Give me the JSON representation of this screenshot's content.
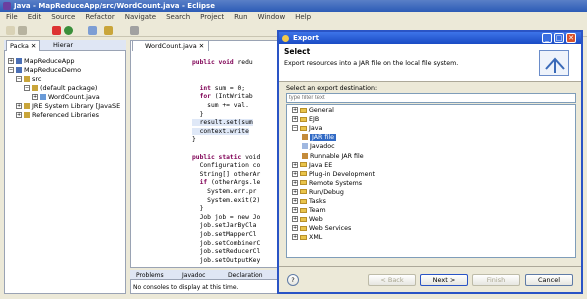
{
  "window": {
    "title": "Java - MapReduceApp/src/WordCount.java - Eclipse"
  },
  "menu": [
    "File",
    "Edit",
    "Source",
    "Refactor",
    "Navigate",
    "Search",
    "Project",
    "Run",
    "Window",
    "Help"
  ],
  "left_panel": {
    "tabs": [
      "Packa",
      "Hierar"
    ],
    "tree": [
      {
        "label": "MapReduceApp",
        "depth": 0,
        "toggle": "+"
      },
      {
        "label": "MapReduceDemo",
        "depth": 0,
        "toggle": "−"
      },
      {
        "label": "src",
        "depth": 1,
        "toggle": "−"
      },
      {
        "label": "(default package)",
        "depth": 2,
        "toggle": "−"
      },
      {
        "label": "WordCount.java",
        "depth": 3,
        "toggle": "+"
      },
      {
        "label": "JRE System Library [JavaSE",
        "depth": 1,
        "toggle": "+"
      },
      {
        "label": "Referenced Libraries",
        "depth": 1,
        "toggle": "+"
      }
    ]
  },
  "editor": {
    "tab": "WordCount.java",
    "lines": [
      {
        "kw": "public void ",
        "text": "redu"
      },
      {
        "kw": "",
        "text": ""
      },
      {
        "kw": "",
        "text": ""
      },
      {
        "kw": "  int ",
        "text": "sum = 0;"
      },
      {
        "kw": "  for ",
        "text": "(IntWritab"
      },
      {
        "kw": "",
        "text": "    sum += val."
      },
      {
        "kw": "",
        "text": "  }"
      },
      {
        "kw": "",
        "text": "  result.set(sum"
      },
      {
        "kw": "",
        "text": "  context.write"
      },
      {
        "kw": "",
        "text": "}"
      },
      {
        "kw": "",
        "text": ""
      },
      {
        "kw": "public static ",
        "text": "void"
      },
      {
        "kw": "",
        "text": "  Configuration co"
      },
      {
        "kw": "",
        "text": "  String[] otherAr"
      },
      {
        "kw": "  if ",
        "text": "(otherArgs.le"
      },
      {
        "kw": "",
        "text": "    System.err.pr"
      },
      {
        "kw": "",
        "text": "    System.exit(2)"
      },
      {
        "kw": "",
        "text": "  }"
      },
      {
        "kw": "",
        "text": "  Job job = new Jo"
      },
      {
        "kw": "",
        "text": "  job.setJarByCla"
      },
      {
        "kw": "",
        "text": "  job.setMapperCl"
      },
      {
        "kw": "",
        "text": "  job.setCombinerC"
      },
      {
        "kw": "",
        "text": "  job.setReducerCl"
      },
      {
        "kw": "",
        "text": "  job.setOutputKey"
      }
    ]
  },
  "bottom_panel": {
    "tabs": [
      "Problems",
      "Javadoc",
      "Declaration"
    ],
    "message": "No consoles to display at this time."
  },
  "dialog": {
    "title": "Export",
    "header_title": "Select",
    "header_desc": "Export resources into a JAR file on the local file system.",
    "dest_label": "Select an export destination:",
    "filter_placeholder": "type filter text",
    "tree": [
      {
        "label": "General",
        "depth": 0,
        "toggle": "+",
        "type": "folder"
      },
      {
        "label": "EJB",
        "depth": 0,
        "toggle": "+",
        "type": "folder"
      },
      {
        "label": "Java",
        "depth": 0,
        "toggle": "−",
        "type": "folder"
      },
      {
        "label": "JAR file",
        "depth": 1,
        "toggle": "",
        "type": "jar",
        "selected": true
      },
      {
        "label": "Javadoc",
        "depth": 1,
        "toggle": "",
        "type": "doc"
      },
      {
        "label": "Runnable JAR file",
        "depth": 1,
        "toggle": "",
        "type": "jar"
      },
      {
        "label": "Java EE",
        "depth": 0,
        "toggle": "+",
        "type": "folder"
      },
      {
        "label": "Plug-in Development",
        "depth": 0,
        "toggle": "+",
        "type": "folder"
      },
      {
        "label": "Remote Systems",
        "depth": 0,
        "toggle": "+",
        "type": "folder"
      },
      {
        "label": "Run/Debug",
        "depth": 0,
        "toggle": "+",
        "type": "folder"
      },
      {
        "label": "Tasks",
        "depth": 0,
        "toggle": "+",
        "type": "folder"
      },
      {
        "label": "Team",
        "depth": 0,
        "toggle": "+",
        "type": "folder"
      },
      {
        "label": "Web",
        "depth": 0,
        "toggle": "+",
        "type": "folder"
      },
      {
        "label": "Web Services",
        "depth": 0,
        "toggle": "+",
        "type": "folder"
      },
      {
        "label": "XML",
        "depth": 0,
        "toggle": "+",
        "type": "folder"
      }
    ],
    "buttons": {
      "back": "< Back",
      "next": "Next >",
      "finish": "Finish",
      "cancel": "Cancel",
      "help": "?"
    }
  },
  "colors": {
    "accent": "#2a54c5",
    "selection": "#316ac5"
  }
}
